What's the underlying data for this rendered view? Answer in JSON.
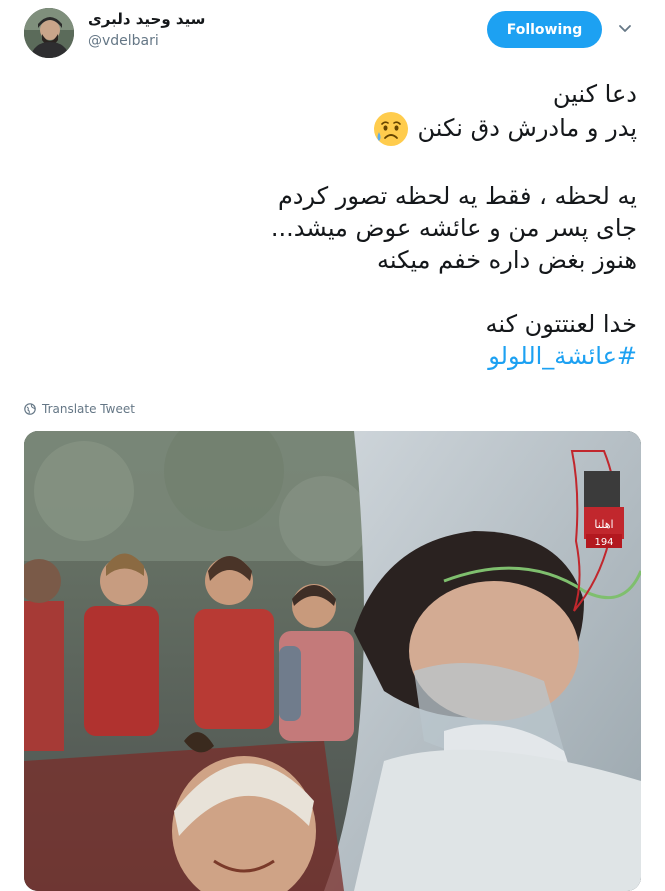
{
  "user": {
    "display_name": "سید وحید دلبری",
    "handle": "@vdelbari"
  },
  "follow_button": {
    "label": "Following"
  },
  "tweet": {
    "line1": "دعا کنین",
    "line2": "پدر و مادرش دق نکنن",
    "line3": "یه لحظه ، فقط یه لحظه تصور کردم",
    "line4": "جای پسر من و عائشه عوض میشد...",
    "line5": "هنوز بغض داره خفم میکنه",
    "line6": "خدا لعنتتون کنه",
    "hashtag": "#عائشة_اللولو"
  },
  "translate": {
    "label": "Translate Tweet"
  },
  "media": {
    "logo_text": "اهلنا",
    "logo_number": "194"
  },
  "colors": {
    "accent": "#1da1f2",
    "text": "#14171a",
    "muted": "#657786"
  },
  "icons": [
    "avatar",
    "chevron-down-icon",
    "sad-tear-emoji-icon",
    "globe-icon"
  ]
}
